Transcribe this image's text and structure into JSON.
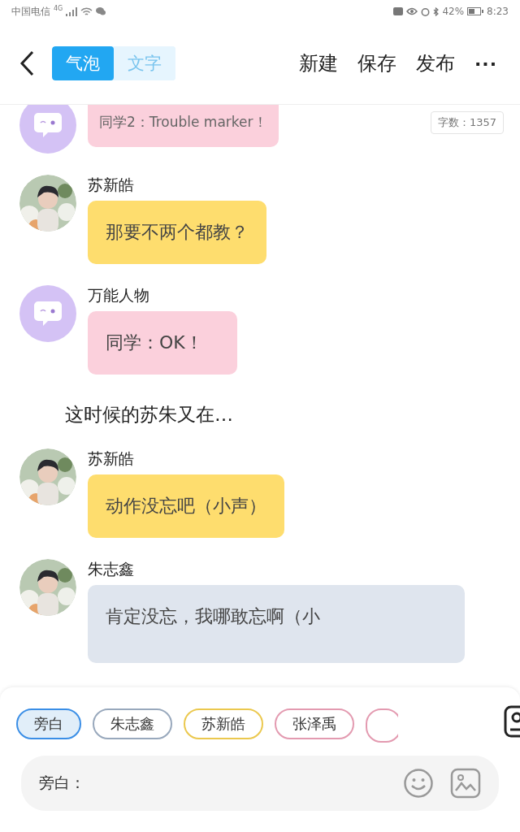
{
  "status_bar": {
    "carrier": "中国电信",
    "network": "4G",
    "battery": "42%",
    "time": "8:23"
  },
  "header": {
    "modes": [
      {
        "label": "气泡",
        "selected": true
      },
      {
        "label": "文字",
        "selected": false
      }
    ],
    "actions": [
      "新建",
      "保存",
      "发布"
    ],
    "more": "···"
  },
  "word_count": "字数：1357",
  "messages": [
    {
      "kind": "message",
      "photo_avatar": false,
      "text": "同学2：Trouble marker！",
      "color": "#fbd0dc"
    },
    {
      "kind": "message",
      "photo_avatar": true,
      "name": "苏新皓",
      "text": "那要不两个都教？",
      "color": "#fedd6e"
    },
    {
      "kind": "message",
      "photo_avatar": false,
      "name": "万能人物",
      "text": "同学：OK！",
      "color": "#fbd0dc"
    },
    {
      "kind": "narration",
      "text": "这时候的苏朱又在…"
    },
    {
      "kind": "message",
      "photo_avatar": true,
      "name": "苏新皓",
      "text": "动作没忘吧（小声）",
      "color": "#fedd6e"
    },
    {
      "kind": "message",
      "photo_avatar": true,
      "name": "朱志鑫",
      "text": "肯定没忘，我哪敢忘啊（小",
      "color": "#dfe5ee"
    }
  ],
  "roles": [
    {
      "label": "旁白",
      "selected": true,
      "color": "#3a8ee6"
    },
    {
      "label": "朱志鑫",
      "selected": false,
      "color": "#98a8bc"
    },
    {
      "label": "苏新皓",
      "selected": false,
      "color": "#ebc84e"
    },
    {
      "label": "张泽禹",
      "selected": false,
      "color": "#e39ab0"
    }
  ],
  "input": {
    "value": "旁白："
  }
}
